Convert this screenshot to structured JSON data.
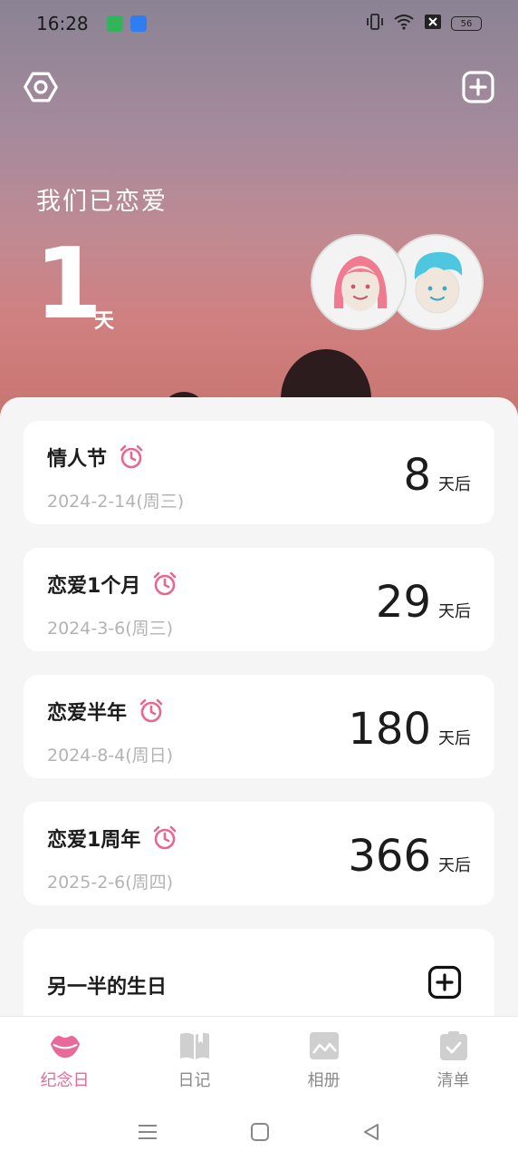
{
  "status_bar": {
    "time": "16:28",
    "battery": "56",
    "icons": [
      "vibrate-icon",
      "wifi-icon",
      "sim-off-icon"
    ]
  },
  "header": {
    "settings_icon": "settings-hex-icon",
    "add_icon": "add-square-icon",
    "love_label": "我们已恋爱",
    "days": "1",
    "days_unit": "天"
  },
  "avatars": {
    "girl": "girl-avatar",
    "boy": "boy-avatar"
  },
  "anniversaries": [
    {
      "title": "情人节",
      "date": "2024-2-14(周三)",
      "count": "8",
      "unit": "天后"
    },
    {
      "title": "恋爱1个月",
      "date": "2024-3-6(周三)",
      "count": "29",
      "unit": "天后"
    },
    {
      "title": "恋爱半年",
      "date": "2024-8-4(周日)",
      "count": "180",
      "unit": "天后"
    },
    {
      "title": "恋爱1周年",
      "date": "2025-2-6(周四)",
      "count": "366",
      "unit": "天后"
    }
  ],
  "birthday": {
    "title": "另一半的生日"
  },
  "colors": {
    "accent_pink": "#e86a9a",
    "alarm_pink": "#e8678f"
  },
  "nav": [
    {
      "label": "纪念日",
      "icon": "lips-icon",
      "active": true
    },
    {
      "label": "日记",
      "icon": "book-icon",
      "active": false
    },
    {
      "label": "相册",
      "icon": "photo-icon",
      "active": false
    },
    {
      "label": "清单",
      "icon": "checklist-icon",
      "active": false
    }
  ]
}
